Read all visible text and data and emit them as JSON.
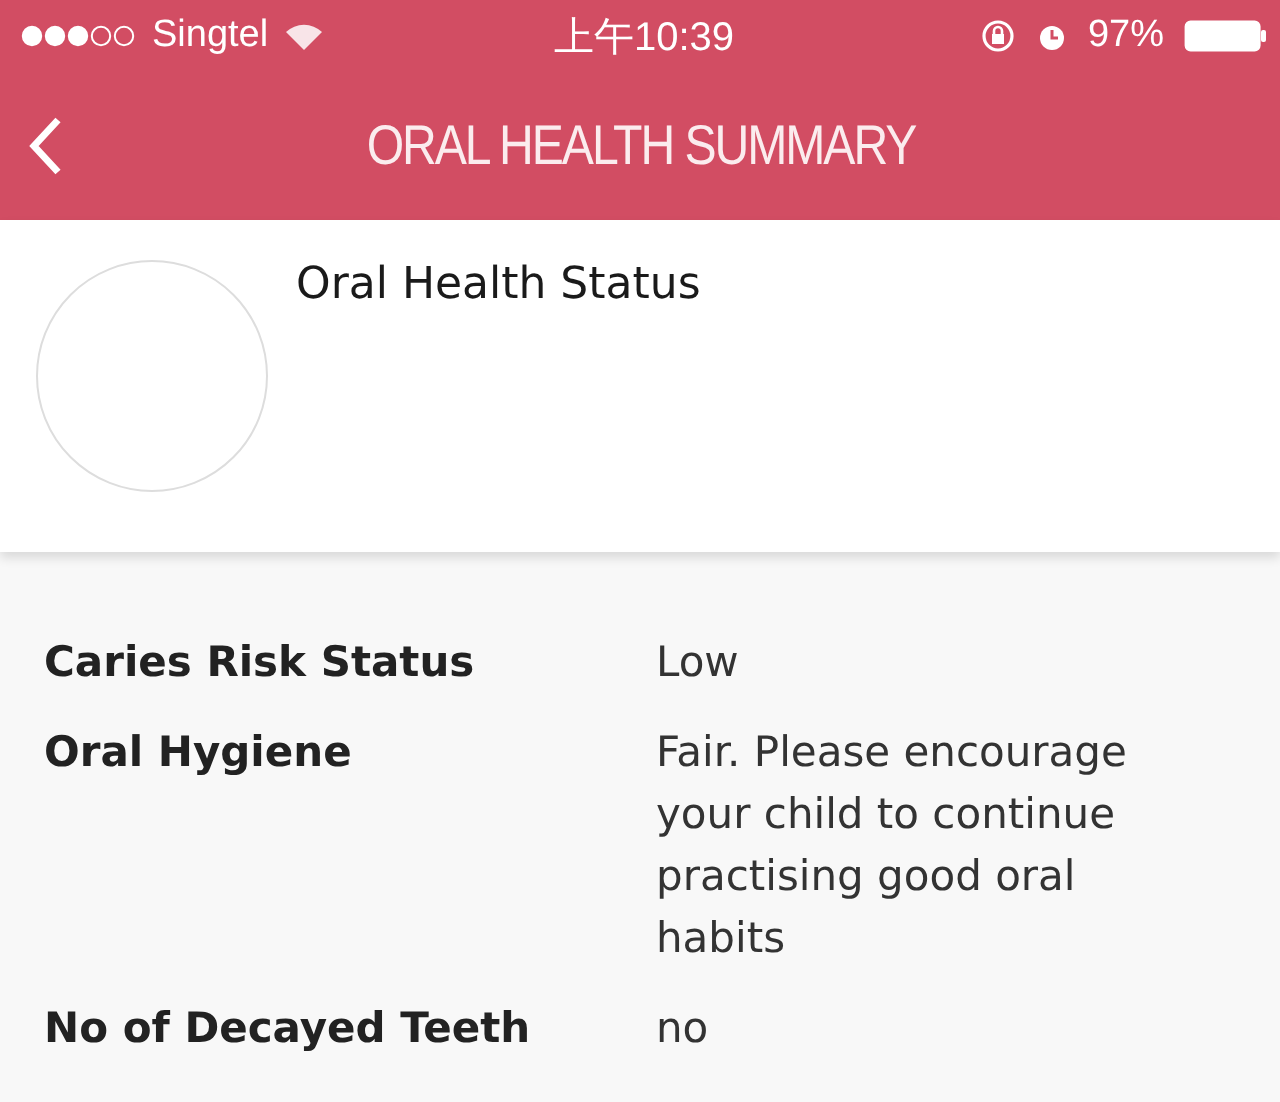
{
  "status_bar": {
    "carrier": "Singtel",
    "time": "上午10:39",
    "battery": "97%"
  },
  "nav": {
    "title": "ORAL HEALTH SUMMARY"
  },
  "header": {
    "title": "Oral Health Status"
  },
  "rows": [
    {
      "label": "Caries Risk Status",
      "value": "Low"
    },
    {
      "label": "Oral Hygiene",
      "value": "Fair. Please encourage your child to continue practising good oral habits"
    },
    {
      "label": "No of Decayed Teeth",
      "value": "no"
    }
  ]
}
